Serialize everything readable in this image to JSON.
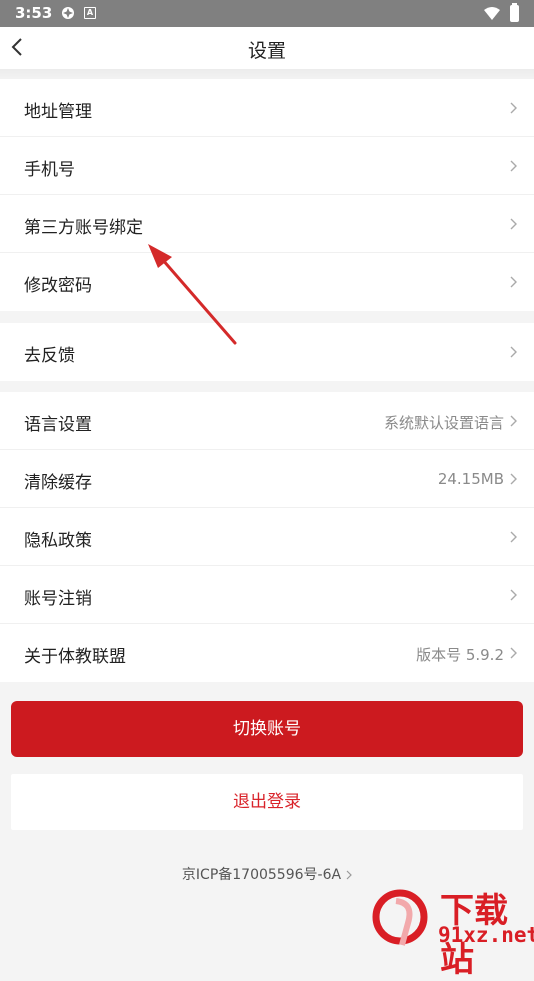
{
  "status_bar": {
    "time": "3:53",
    "badge": "A"
  },
  "header": {
    "title": "设置"
  },
  "groups": [
    {
      "items": [
        {
          "label": "地址管理",
          "value": ""
        },
        {
          "label": "手机号",
          "value": ""
        },
        {
          "label": "第三方账号绑定",
          "value": ""
        },
        {
          "label": "修改密码",
          "value": ""
        }
      ]
    },
    {
      "items": [
        {
          "label": "去反馈",
          "value": ""
        }
      ]
    },
    {
      "items": [
        {
          "label": "语言设置",
          "value": "系统默认设置语言"
        },
        {
          "label": "清除缓存",
          "value": "24.15MB"
        },
        {
          "label": "隐私政策",
          "value": ""
        },
        {
          "label": "账号注销",
          "value": ""
        },
        {
          "label": "关于体教联盟",
          "value": "版本号 5.9.2"
        }
      ]
    }
  ],
  "buttons": {
    "switch_account": "切换账号",
    "logout": "退出登录"
  },
  "footer": {
    "icp": "京ICP备17005596号-6A"
  },
  "watermark": {
    "text": "下载站",
    "url": "91xz.net"
  },
  "colors": {
    "accent": "#cc1a1f",
    "logout_text": "#d9232a",
    "background": "#f4f4f4",
    "annotation_arrow": "#d42a2a"
  }
}
